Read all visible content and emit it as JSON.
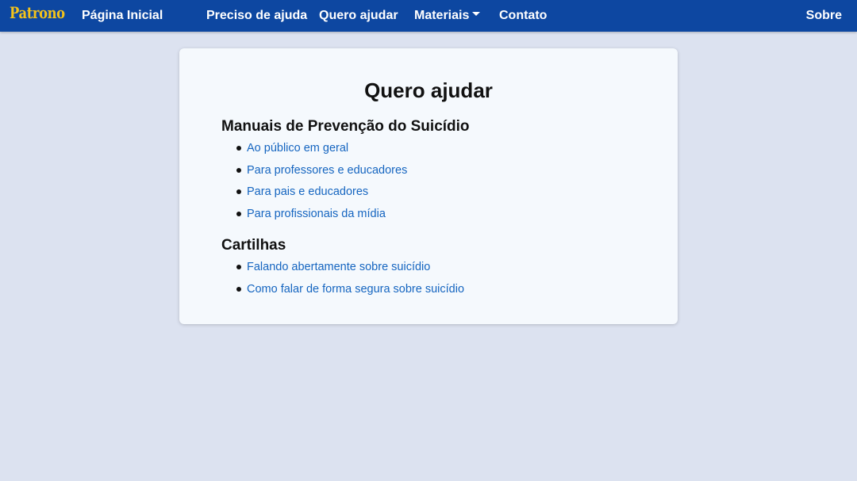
{
  "navbar": {
    "brand": "Patrono",
    "home": "Página Inicial",
    "need_help": "Preciso de ajuda",
    "want_help": "Quero ajudar",
    "materials": "Materiais",
    "contact": "Contato",
    "about": "Sobre"
  },
  "main": {
    "title": "Quero ajudar",
    "sections": [
      {
        "title": "Manuais de Prevenção do Suicídio",
        "links": [
          "Ao público em geral",
          "Para professores e educadores",
          "Para pais e educadores",
          "Para profissionais da mídia"
        ]
      },
      {
        "title": "Cartilhas",
        "links": [
          "Falando abertamente sobre suicídio",
          "Como falar de forma segura sobre suicídio"
        ]
      }
    ]
  },
  "colors": {
    "navbar": "#0d47a1",
    "brand": "#f2c21b",
    "page_background": "#dce2f0",
    "card_background": "#f5f9fd",
    "link": "#1565c0"
  }
}
